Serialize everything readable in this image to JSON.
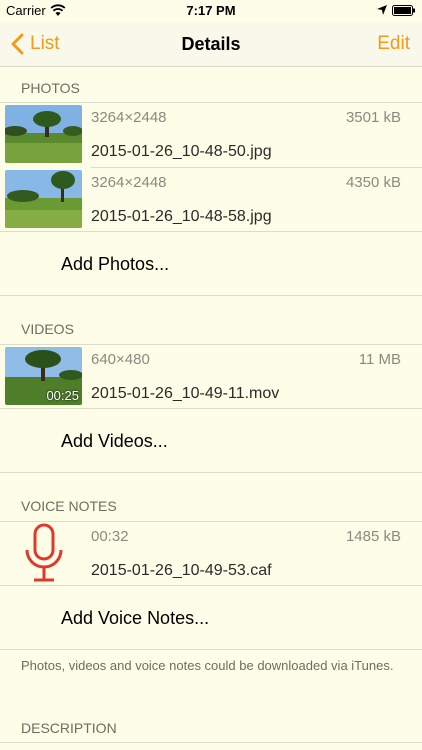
{
  "status_bar": {
    "carrier": "Carrier",
    "time": "7:17 PM"
  },
  "nav": {
    "back_label": "List",
    "title": "Details",
    "edit_label": "Edit"
  },
  "photos": {
    "header": "PHOTOS",
    "items": [
      {
        "dimensions": "3264×2448",
        "size": "3501 kB",
        "filename": "2015-01-26_10-48-50.jpg"
      },
      {
        "dimensions": "3264×2448",
        "size": "4350 kB",
        "filename": "2015-01-26_10-48-58.jpg"
      }
    ],
    "add_label": "Add Photos..."
  },
  "videos": {
    "header": "VIDEOS",
    "items": [
      {
        "dimensions": "640×480",
        "size": "11 MB",
        "filename": "2015-01-26_10-49-11.mov",
        "duration": "00:25"
      }
    ],
    "add_label": "Add Videos..."
  },
  "voice_notes": {
    "header": "VOICE NOTES",
    "items": [
      {
        "duration": "00:32",
        "size": "1485 kB",
        "filename": "2015-01-26_10-49-53.caf"
      }
    ],
    "add_label": "Add Voice Notes..."
  },
  "footer_note": "Photos, videos and voice notes could be downloaded via iTunes.",
  "description": {
    "header": "DESCRIPTION"
  },
  "colors": {
    "accent": "#f29a1a",
    "background": "#fdfde8",
    "mic": "#e0392b"
  }
}
